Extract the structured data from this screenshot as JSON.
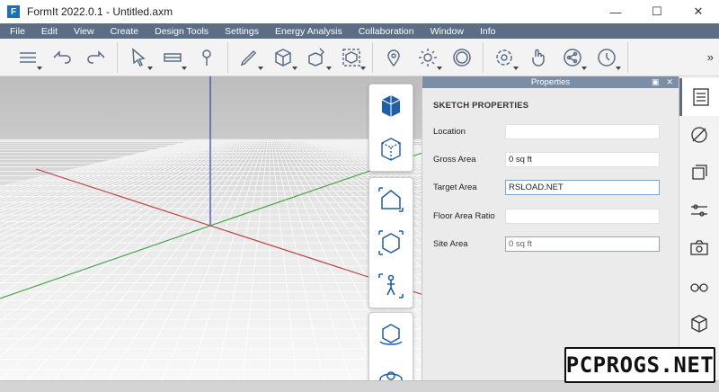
{
  "window": {
    "title": "FormIt 2022.0.1 - Untitled.axm",
    "logo_letter": "F",
    "controls": {
      "minimize": "—",
      "maximize": "☐",
      "close": "✕"
    }
  },
  "menu": [
    "File",
    "Edit",
    "View",
    "Create",
    "Design Tools",
    "Settings",
    "Energy Analysis",
    "Collaboration",
    "Window",
    "Info"
  ],
  "toolbar": {
    "more_glyph": "»",
    "groups": [
      [
        "layers-icon",
        "undo-icon",
        "redo-icon"
      ],
      [
        "select-icon",
        "tape-measure-icon",
        "pin-icon"
      ],
      [
        "pencil-icon",
        "cube-icon",
        "cube-edit-icon",
        "cube-transform-icon"
      ],
      [
        "location-icon",
        "sun-icon",
        "scale-icon"
      ],
      [
        "settings-icon",
        "gesture-icon",
        "share-icon",
        "help-icon"
      ]
    ]
  },
  "floating_tools": [
    [
      "view-cube-icon",
      "wireframe-icon"
    ],
    [
      "home-view-icon",
      "box-view-icon",
      "walk-icon"
    ],
    [
      "orbit-icon",
      "look-around-icon"
    ]
  ],
  "properties": {
    "panel_title": "Properties",
    "header_buttons": {
      "pin": "▣",
      "close": "✕"
    },
    "section_title": "SKETCH PROPERTIES",
    "fields": [
      {
        "label": "Location",
        "value": "",
        "style": "normal"
      },
      {
        "label": "Gross Area",
        "value": "0 sq ft",
        "style": "normal"
      },
      {
        "label": "Target Area",
        "value": "RSLOAD.NET",
        "style": "focus"
      },
      {
        "label": "Floor Area Ratio",
        "value": "",
        "style": "normal"
      },
      {
        "label": "Site Area",
        "value": "0 sq ft",
        "style": "dim"
      }
    ]
  },
  "rail": [
    "properties-panel-icon",
    "materials-icon",
    "layers-panel-icon",
    "levels-icon",
    "scenes-icon",
    "view-options-icon",
    "groups-icon"
  ],
  "watermark": "PCPROGS.NET"
}
